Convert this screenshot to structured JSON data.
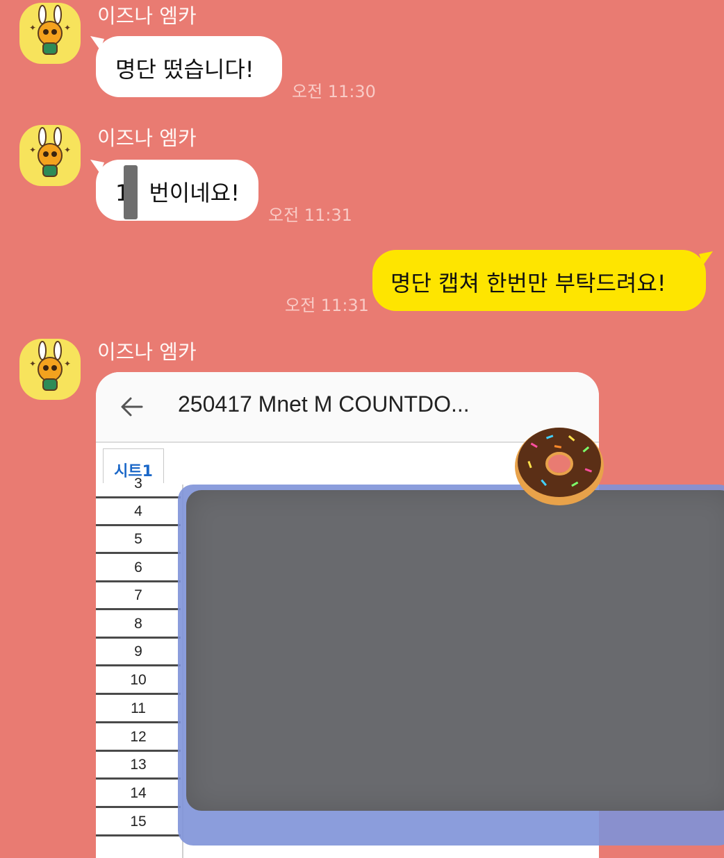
{
  "messages": [
    {
      "sender": "이즈나 엠카",
      "text": "명단 떴습니다!",
      "time": "오전 11:30"
    },
    {
      "sender": "이즈나 엠카",
      "text_before": "1",
      "text_after": "번이네요!",
      "time": "오전 11:31"
    },
    {
      "text": "명단 캡쳐 한번만 부탁드려요!",
      "time": "오전 11:31"
    },
    {
      "sender": "이즈나 엠카"
    }
  ],
  "screenshot": {
    "title": "250417 Mnet M COUNTDO...",
    "tab": "시트1",
    "rows": [
      "3",
      "4",
      "5",
      "6",
      "7",
      "8",
      "9",
      "10",
      "11",
      "12",
      "13",
      "14",
      "15"
    ]
  },
  "colors": {
    "background": "#e97b72",
    "incoming_bubble": "#ffffff",
    "outgoing_bubble": "#fee500",
    "avatar_bg": "#f7e35c"
  },
  "icons": {
    "avatar": "rabbit-character-icon",
    "back": "arrow-left-icon",
    "sticker": "donut-icon"
  }
}
